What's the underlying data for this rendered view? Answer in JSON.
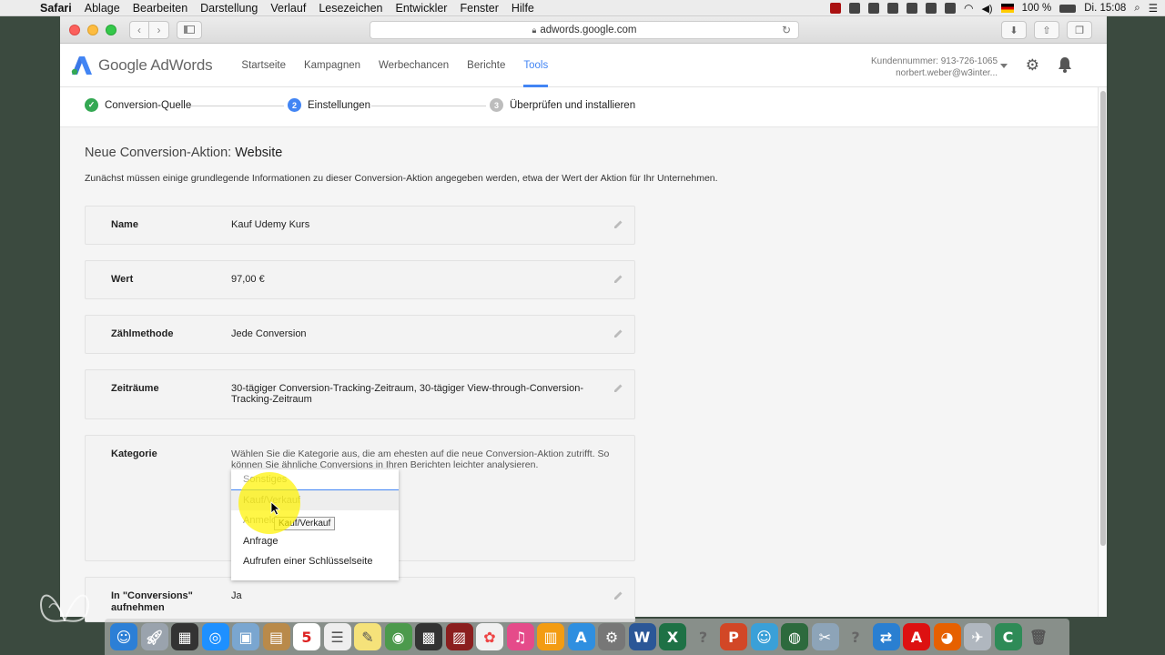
{
  "menubar": {
    "app": "Safari",
    "items": [
      "Ablage",
      "Bearbeiten",
      "Darstellung",
      "Verlauf",
      "Lesezeichen",
      "Entwickler",
      "Fenster",
      "Hilfe"
    ],
    "battery": "100 %",
    "clock": "Di. 15:08"
  },
  "browser": {
    "url": "adwords.google.com"
  },
  "adwords": {
    "logo_text": "Google AdWords",
    "nav": [
      "Startseite",
      "Kampagnen",
      "Werbechancen",
      "Berichte",
      "Tools"
    ],
    "active_tab": "Tools",
    "account_line1": "Kundennummer: 913-726-1065",
    "account_line2": "norbert.weber@w3inter..."
  },
  "stepper": {
    "steps": [
      {
        "num": "✓",
        "label": "Conversion-Quelle",
        "state": "done"
      },
      {
        "num": "2",
        "label": "Einstellungen",
        "state": "current"
      },
      {
        "num": "3",
        "label": "Überprüfen und installieren",
        "state": "todo"
      }
    ]
  },
  "page": {
    "title_prefix": "Neue Conversion-Aktion:",
    "title_type": "Website",
    "intro": "Zunächst müssen einige grundlegende Informationen zu dieser Conversion-Aktion angegeben werden, etwa der Wert der Aktion für Ihr Unternehmen."
  },
  "fields": [
    {
      "label": "Name",
      "value": "Kauf Udemy Kurs"
    },
    {
      "label": "Wert",
      "value": "97,00 €"
    },
    {
      "label": "Zählmethode",
      "value": "Jede Conversion"
    },
    {
      "label": "Zeiträume",
      "value": "30-tägiger Conversion-Tracking-Zeitraum, 30-tägiger View-through-Conversion-Tracking-Zeitraum"
    },
    {
      "label": "Kategorie",
      "value": "Wählen Sie die Kategorie aus, die am ehesten auf die neue Conversion-Aktion zutrifft. So können Sie ähnliche Conversions in Ihren Berichten leichter analysieren."
    },
    {
      "label": "In \"Conversions\" aufnehmen",
      "value": "Ja"
    }
  ],
  "category_dropdown": {
    "options": [
      "Sonstiges",
      "Kauf/Verkauf",
      "Anmeldung",
      "Anfrage",
      "Aufrufen einer Schlüsselseite"
    ],
    "highlighted": "Kauf/Verkauf",
    "tooltip": "Kauf/Verkauf"
  },
  "colors": {
    "accent": "#4285f4",
    "done": "#34a853"
  }
}
